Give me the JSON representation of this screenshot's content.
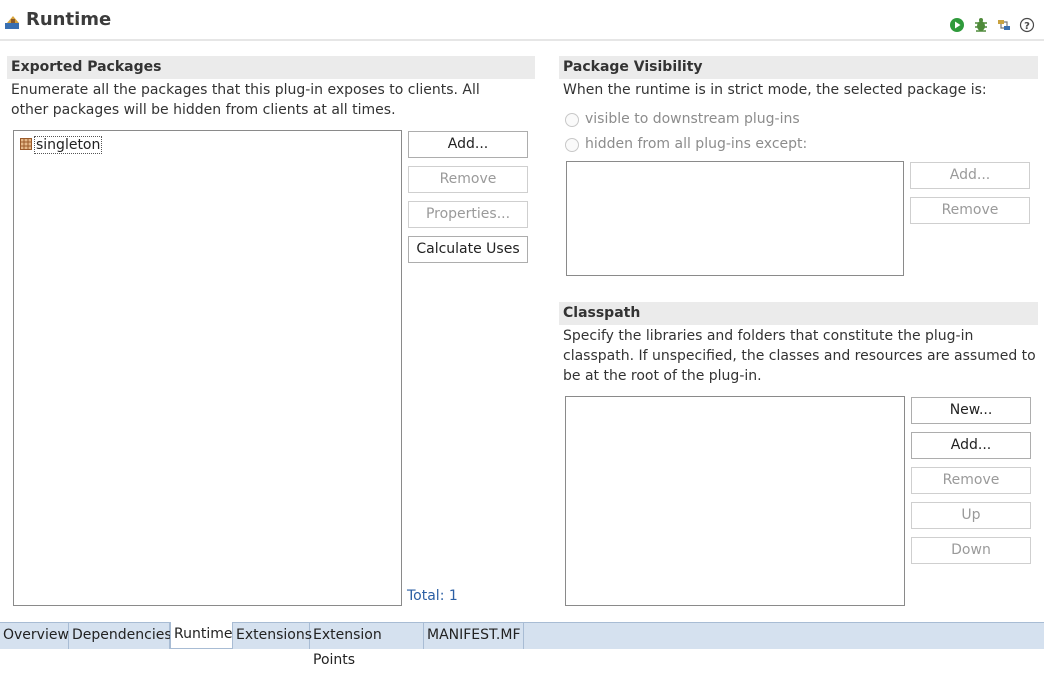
{
  "header": {
    "title": "Runtime",
    "toolbar": {
      "run_icon": "run-icon",
      "debug_icon": "debug-icon",
      "export_icon": "export-icon",
      "help_icon": "help-icon"
    }
  },
  "exported_packages": {
    "title": "Exported Packages",
    "description": "Enumerate all the packages that this plug-in exposes to clients.  All other packages will be hidden from clients at all times.",
    "items": [
      "singleton"
    ],
    "buttons": {
      "add": "Add...",
      "remove": "Remove",
      "properties": "Properties...",
      "calculate_uses": "Calculate Uses"
    },
    "total": "Total: 1"
  },
  "package_visibility": {
    "title": "Package Visibility",
    "description": "When the runtime is in strict mode, the selected package is:",
    "option_visible": "visible to downstream plug-ins",
    "option_hidden": "hidden from all plug-ins except:",
    "buttons": {
      "add": "Add...",
      "remove": "Remove"
    }
  },
  "classpath": {
    "title": "Classpath",
    "description": "Specify the libraries and folders that constitute the plug-in classpath.  If unspecified, the classes and resources are assumed to be at the root of the plug-in.",
    "buttons": {
      "new": "New...",
      "add": "Add...",
      "remove": "Remove",
      "up": "Up",
      "down": "Down"
    }
  },
  "tabs": [
    "Overview",
    "Dependencies",
    "Runtime",
    "Extensions",
    "Extension Points",
    "MANIFEST.MF"
  ],
  "active_tab": "Runtime",
  "colors": {
    "section_bg": "#ebebeb",
    "tabbar_bg": "#d5e1ef",
    "link_blue": "#2b5fa4"
  }
}
